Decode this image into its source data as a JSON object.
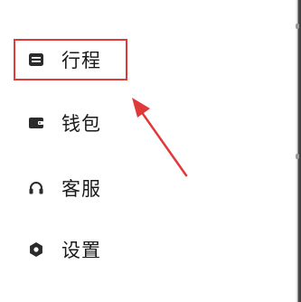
{
  "menu": {
    "items": [
      {
        "label": "行程",
        "icon": "ticket-icon"
      },
      {
        "label": "钱包",
        "icon": "wallet-icon"
      },
      {
        "label": "客服",
        "icon": "headset-icon"
      },
      {
        "label": "设置",
        "icon": "gear-icon"
      }
    ]
  },
  "annotation": {
    "highlight_color": "#e0393a",
    "highlighted_item": "行程"
  },
  "colors": {
    "text": "#1a1a1a",
    "icon": "#2b2b2b",
    "background": "#ffffff"
  }
}
